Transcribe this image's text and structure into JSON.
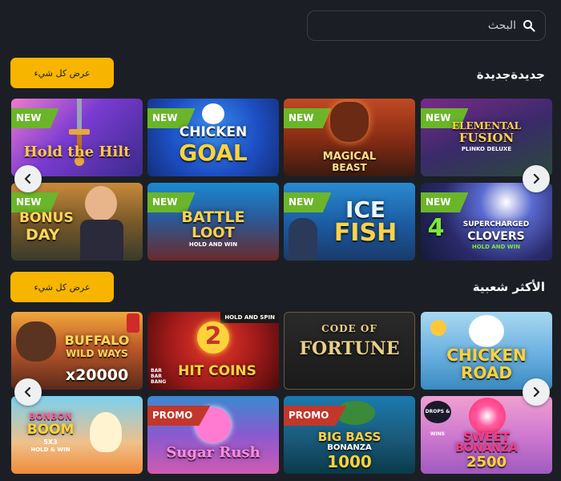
{
  "search": {
    "placeholder": "البحث",
    "icon": "search-icon"
  },
  "sections": [
    {
      "title": "جديدةجديدة",
      "view_all_label": "عرض كل شيء",
      "games": [
        {
          "name": "Hold the Hilt",
          "badge": "NEW"
        },
        {
          "name": "Chicken Goal",
          "title1": "CHICKEN",
          "title2": "GOAL",
          "badge": "NEW"
        },
        {
          "name": "Magical Beast",
          "title1": "MAGICAL",
          "title2": "BEAST",
          "badge": "NEW"
        },
        {
          "name": "Elemental Fusion",
          "title1": "ELEMENTAL",
          "title2": "FUSION",
          "sub": "PLINKO DELUXE",
          "badge": "NEW"
        },
        {
          "name": "Bonus Day",
          "title1": "BONUS",
          "title2": "DAY",
          "badge": "NEW"
        },
        {
          "name": "Battle Loot",
          "title1": "BATTLE",
          "title2": "LOOT",
          "sub": "HOLD AND WIN",
          "badge": "NEW"
        },
        {
          "name": "Ice Fish",
          "title1": "ICE",
          "title2": "FISH",
          "badge": "NEW"
        },
        {
          "name": "4 Supercharged Clovers",
          "num": "4",
          "title1": "SUPERCHARGED",
          "title2": "CLOVERS",
          "sub": "HOLD AND WIN",
          "badge": "NEW"
        }
      ]
    },
    {
      "title": "الأكثر شعبية",
      "view_all_label": "عرض كل شيء",
      "games": [
        {
          "name": "Buffalo Wild Ways",
          "title1": "BUFFALO",
          "title2": "WILD WAYS",
          "mult": "x20000"
        },
        {
          "name": "Hit Coins",
          "tag": "HOLD AND SPIN",
          "num": "2",
          "title1": "HIT COINS",
          "brand": "BAR BAR BANG"
        },
        {
          "name": "Code of Fortune",
          "title1": "CODE OF",
          "title2": "FORTUNE"
        },
        {
          "name": "Chicken Road",
          "title1": "CHICKEN",
          "title2": "ROAD"
        },
        {
          "name": "BonBon Boom",
          "title1": "BONBON",
          "title2": "BOOM",
          "num": "5X3",
          "sub": "HOLD & WIN"
        },
        {
          "name": "Sugar Rush",
          "title1": "Sugar Rush",
          "badge": "PROMO"
        },
        {
          "name": "Big Bass Bonanza 1000",
          "title1": "BIG BASS",
          "title2": "BONANZA",
          "num": "1000",
          "badge": "PROMO"
        },
        {
          "name": "Sweet Bonanza 2500",
          "tag": "DROPS & WINS",
          "title1": "SWEET",
          "title2": "BONANZA",
          "num": "2500"
        }
      ]
    }
  ],
  "colors": {
    "background": "#1b1f25",
    "accent": "#f7b500",
    "new_badge": "#6bb52a",
    "promo_badge": "#c1372b"
  },
  "icons": {
    "prev": "chevron-left-icon",
    "next": "chevron-right-icon"
  }
}
